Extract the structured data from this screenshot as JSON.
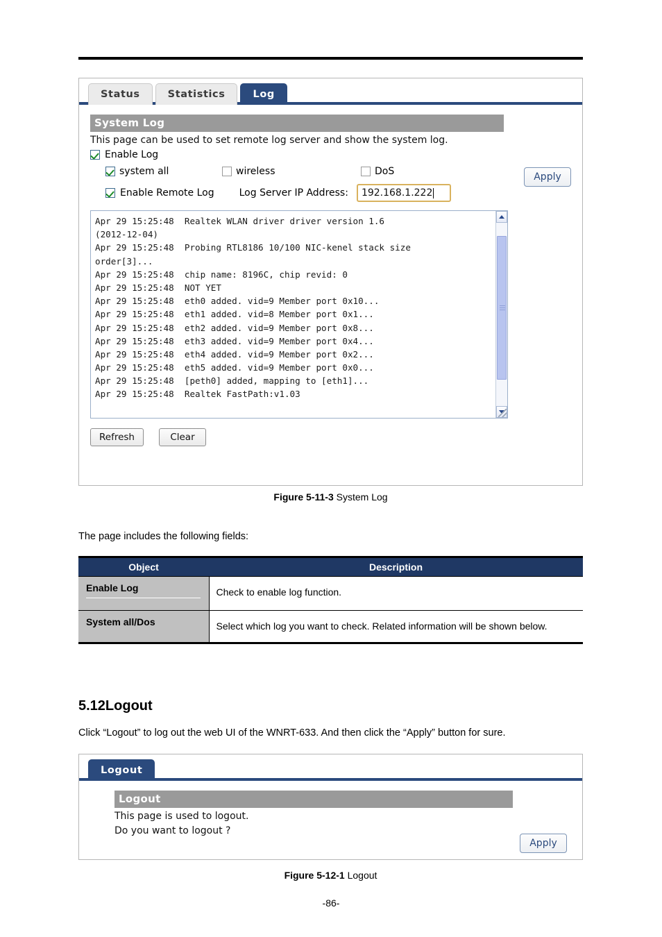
{
  "header": {
    "rule": true
  },
  "log_figure": {
    "tabs": [
      {
        "label": "Status",
        "active": false
      },
      {
        "label": "Statistics",
        "active": false
      },
      {
        "label": "Log",
        "active": true
      }
    ],
    "section_title": "System Log",
    "description": "This page can be used to set remote log server and show the system log.",
    "apply_label": "Apply",
    "enable_log": {
      "label": "Enable Log",
      "checked": true
    },
    "options": [
      {
        "label": "system all",
        "checked": true
      },
      {
        "label": "wireless",
        "checked": false
      },
      {
        "label": "DoS",
        "checked": false
      }
    ],
    "remote": {
      "checkbox_label": "Enable Remote Log",
      "checked": true,
      "ip_label": "Log Server IP Address:",
      "ip_value": "192.168.1.222"
    },
    "log_lines": [
      "Apr 29 15:25:48  Realtek WLAN driver driver version 1.6",
      "(2012-12-04)",
      "Apr 29 15:25:48  Probing RTL8186 10/100 NIC-kenel stack size",
      "order[3]...",
      "Apr 29 15:25:48  chip name: 8196C, chip revid: 0",
      "Apr 29 15:25:48  NOT YET",
      "Apr 29 15:25:48  eth0 added. vid=9 Member port 0x10...",
      "Apr 29 15:25:48  eth1 added. vid=8 Member port 0x1...",
      "Apr 29 15:25:48  eth2 added. vid=9 Member port 0x8...",
      "Apr 29 15:25:48  eth3 added. vid=9 Member port 0x4...",
      "Apr 29 15:25:48  eth4 added. vid=9 Member port 0x2...",
      "Apr 29 15:25:48  eth5 added. vid=9 Member port 0x0...",
      "Apr 29 15:25:48  [peth0] added, mapping to [eth1]...",
      "Apr 29 15:25:48  Realtek FastPath:v1.03"
    ],
    "refresh_label": "Refresh",
    "clear_label": "Clear",
    "caption_bold": "Figure 5-11-3",
    "caption_rest": " System Log"
  },
  "fields_intro": "The page includes the following fields:",
  "fields_table": {
    "headers": [
      "Object",
      "Description"
    ],
    "rows": [
      {
        "object": "Enable Log",
        "description": "Check to enable log function."
      },
      {
        "object": "System all/Dos",
        "description": "Select which log you want to check. Related information will be shown below."
      }
    ]
  },
  "logout_section": {
    "heading": "5.12Logout",
    "intro": "Click “Logout” to log out the web UI of the WNRT-633. And then click the “Apply” button for sure.",
    "tab_label": "Logout",
    "section_title": "Logout",
    "line1": "This page is used to logout.",
    "line2": "Do you want to logout ?",
    "apply_label": "Apply",
    "caption_bold": "Figure 5-12-1",
    "caption_rest": " Logout"
  },
  "page_number": "-86-",
  "colors": {
    "tab_active": "#2b4a7d",
    "section_bar": "#9a9a9a",
    "table_header": "#1f3864",
    "object_cell": "#c0c0c0",
    "input_border": "#d9b25e",
    "scroll_thumb": "#b8c4ef"
  }
}
